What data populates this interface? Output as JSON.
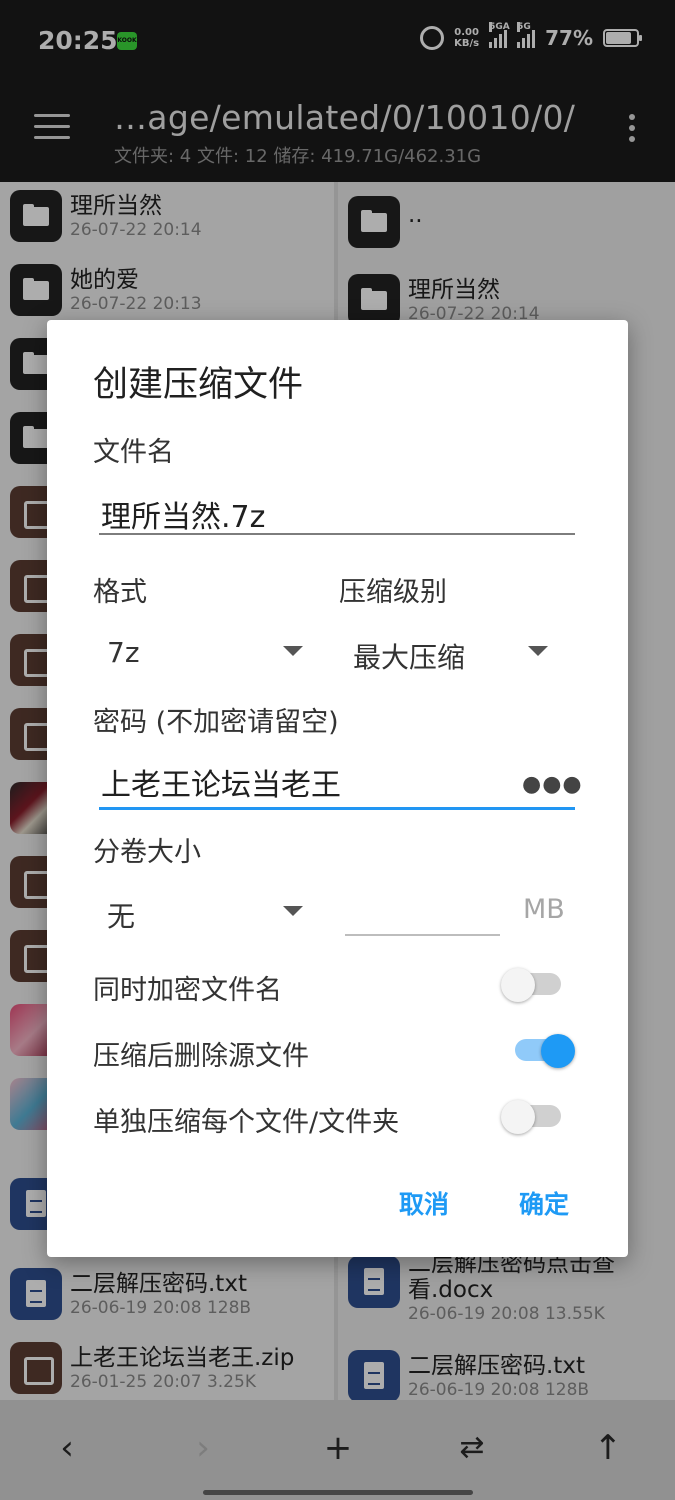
{
  "status": {
    "time": "20:25",
    "badge": "KOOK",
    "net_speed": "0.00",
    "net_unit": "KB/s",
    "sim1": "5GA",
    "sim2": "5G",
    "battery": "77%"
  },
  "appbar": {
    "path": "…age/emulated/0/10010/0/",
    "summary": "文件夹: 4  文件: 12  储存: 419.71G/462.31G"
  },
  "left_pane": {
    "items": [
      {
        "name": "理所当然",
        "meta": "26-07-22 20:14"
      },
      {
        "name": "她的爱",
        "meta": "26-07-22 20:13"
      },
      {
        "name": "二层解压密码.txt",
        "meta": "26-06-19 20:08  128B"
      },
      {
        "name": "上老王论坛当老王.zip",
        "meta": "26-01-25 20:07  3.25K"
      }
    ]
  },
  "right_pane": {
    "items": [
      {
        "name": "..",
        "meta": ""
      },
      {
        "name": "理所当然",
        "meta": "26-07-22 20:14"
      },
      {
        "name": "二层解压密码点击查",
        "name2": "看.docx",
        "meta": "26-06-19 20:08  13.55K"
      },
      {
        "name": "二层解压密码.txt",
        "meta": "26-06-19 20:08  128B"
      }
    ]
  },
  "dialog": {
    "title": "创建压缩文件",
    "filename_label": "文件名",
    "filename_value": "理所当然.7z",
    "format_label": "格式",
    "format_value": "7z",
    "level_label": "压缩级别",
    "level_value": "最大压缩",
    "password_label": "密码 (不加密请留空)",
    "password_value": "上老王论坛当老王",
    "volume_label": "分卷大小",
    "volume_value": "无",
    "volume_unit": "MB",
    "toggles": [
      {
        "label": "同时加密文件名",
        "on": false
      },
      {
        "label": "压缩后删除源文件",
        "on": true
      },
      {
        "label": "单独压缩每个文件/文件夹",
        "on": false
      }
    ],
    "cancel": "取消",
    "ok": "确定"
  },
  "colors": {
    "accent": "#1e9af5",
    "appbar": "#1b1b1b"
  }
}
